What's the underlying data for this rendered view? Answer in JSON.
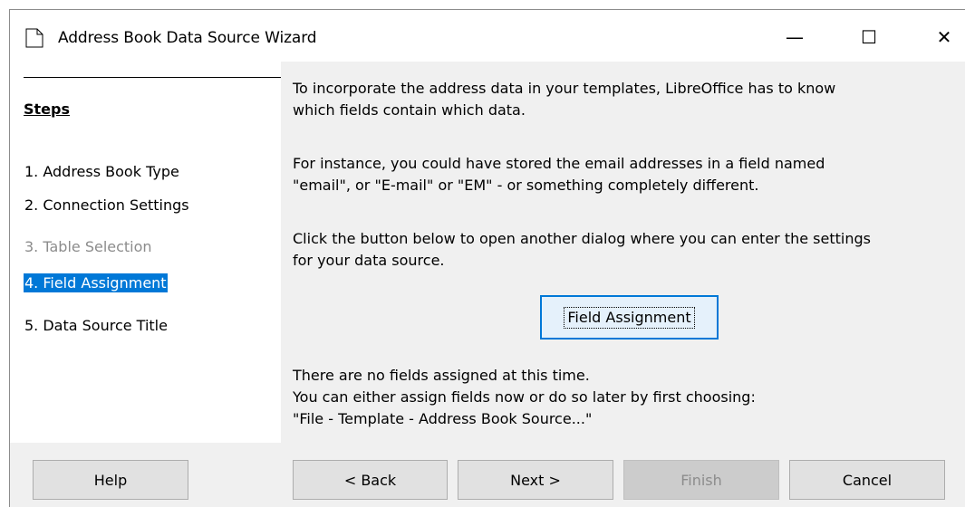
{
  "window": {
    "title": "Address Book Data Source Wizard",
    "minimize_glyph": "—",
    "maximize_glyph": "☐",
    "close_glyph": "✕"
  },
  "sidebar": {
    "heading": "Steps",
    "steps": [
      {
        "label": "1. Address Book Type",
        "state": "normal"
      },
      {
        "label": "2. Connection Settings",
        "state": "normal"
      },
      {
        "label": "3. Table Selection",
        "state": "disabled"
      },
      {
        "label": "4. Field Assignment",
        "state": "selected"
      },
      {
        "label": "5. Data Source Title",
        "state": "normal"
      }
    ]
  },
  "content": {
    "para1_line1": "To incorporate the address data in your templates, LibreOffice has to know",
    "para1_line2": "which fields contain which data.",
    "para2_line1": "For instance, you could have stored the email addresses in a field named",
    "para2_line2": "\"email\", or \"E-mail\" or \"EM\" - or something completely different.",
    "para3_line1": "Click the button below to open another dialog where you can enter the settings",
    "para3_line2": "for your data source.",
    "field_assignment_button": "Field Assignment",
    "status_line1": "There are no fields assigned at this time.",
    "status_line2": "You can either assign fields now or do so later by first choosing:",
    "status_line3": "\"File - Template - Address Book Source...\""
  },
  "footer": {
    "help": "Help",
    "back": "< Back",
    "next": "Next >",
    "finish": "Finish",
    "cancel": "Cancel"
  },
  "colors": {
    "selection": "#0078d7",
    "dialog_background": "#f0f0f0",
    "disabled_text": "#8c8c8c"
  }
}
